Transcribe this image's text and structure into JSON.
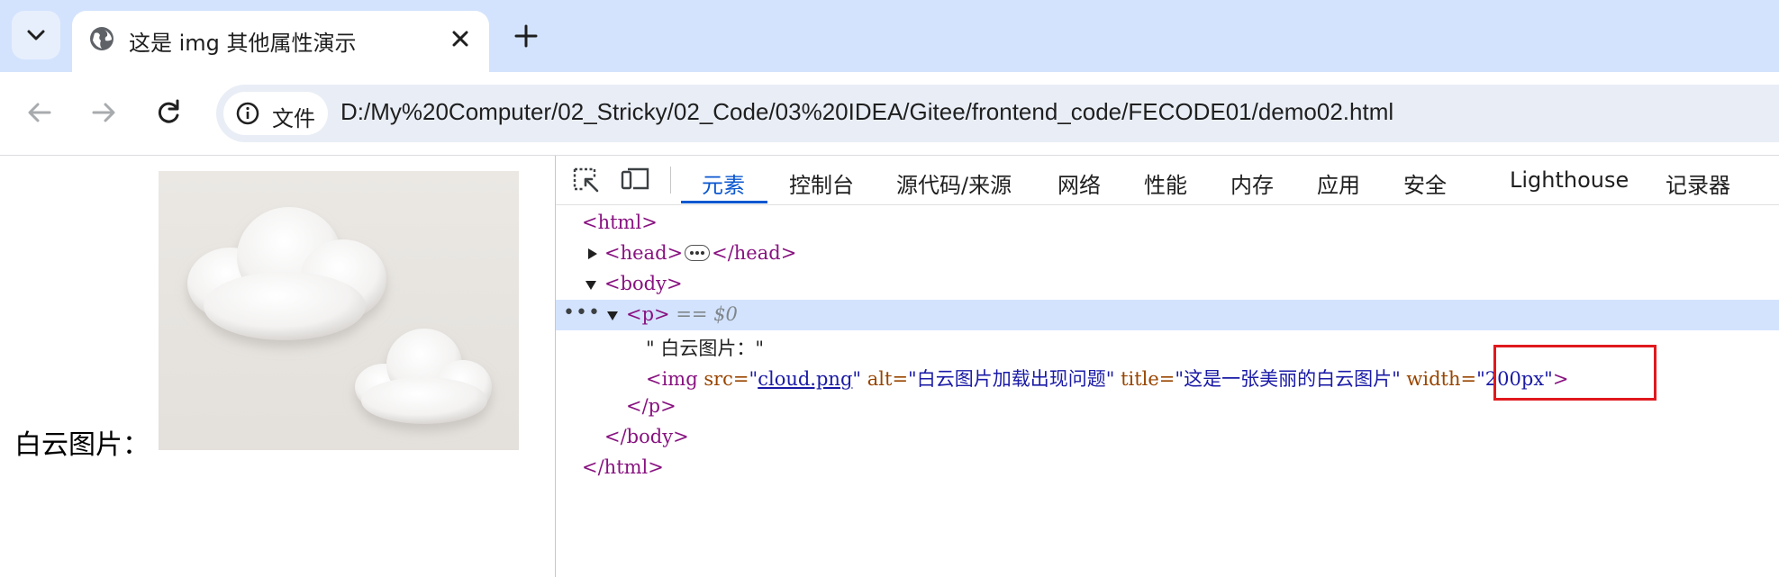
{
  "browser": {
    "tab_title": "这是 img 其他属性演示",
    "site_chip_label": "文件",
    "url": "D:/My%20Computer/02_Stricky/02_Code/03%20IDEA/Gitee/frontend_code/FECODE01/demo02.html"
  },
  "page": {
    "label": "白云图片："
  },
  "devtools": {
    "tabs": [
      {
        "label": "元素"
      },
      {
        "label": "控制台"
      },
      {
        "label": "源代码/来源"
      },
      {
        "label": "网络"
      },
      {
        "label": "性能"
      },
      {
        "label": "内存"
      },
      {
        "label": "应用"
      },
      {
        "label": "安全"
      },
      {
        "label": "Lighthouse"
      },
      {
        "label": "记录器"
      }
    ],
    "active_tab": "元素",
    "dom": {
      "html_open": "<html>",
      "head": {
        "open": "<head>",
        "close": "</head>"
      },
      "body_open": "<body>",
      "p_open": "<p>",
      "selected_marker": "== $0",
      "text_node": "\" 白云图片：\"",
      "img": {
        "tag_open": "<img",
        "src_attr": "src=",
        "src_value": "cloud.png",
        "alt_attr": "alt=",
        "alt_value": "\"白云图片加载出现问题\"",
        "title_attr": "title=",
        "title_value": "\"这是一张美丽的白云图片\"",
        "width_attr": "width=",
        "width_value": "\"200px\"",
        "tag_close": ">"
      },
      "p_close": "</p>",
      "body_close": "</body>",
      "html_close": "</html>"
    }
  },
  "colors": {
    "tabstrip": "#d3e3fd",
    "active_devtools_tab": "#0b57d0",
    "highlight_box": "#e0191d",
    "selected_row": "#d3e3fd"
  }
}
